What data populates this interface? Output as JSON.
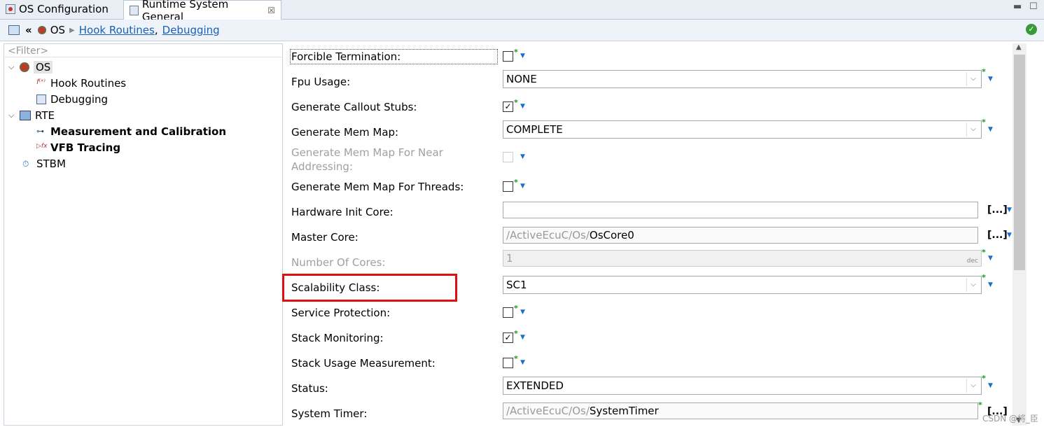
{
  "tabs": [
    {
      "label": "OS Configuration"
    },
    {
      "label": "Runtime System General"
    }
  ],
  "breadcrumb": {
    "root": "OS",
    "links": [
      "Hook Routines",
      "Debugging"
    ],
    "separator": ","
  },
  "tree": {
    "filter_placeholder": "<Filter>",
    "items": [
      {
        "label": "OS",
        "level": 0,
        "expanded": true,
        "selected": true
      },
      {
        "label": "Hook Routines",
        "level": 1
      },
      {
        "label": "Debugging",
        "level": 1
      },
      {
        "label": "RTE",
        "level": 0,
        "expanded": true
      },
      {
        "label": "Measurement and Calibration",
        "level": 1,
        "bold": true
      },
      {
        "label": "VFB Tracing",
        "level": 1,
        "bold": true
      },
      {
        "label": "STBM",
        "level": 0
      }
    ]
  },
  "form": {
    "fields": [
      {
        "label": "Forcible Termination:",
        "type": "checkbox",
        "checked": false
      },
      {
        "label": "Fpu Usage:",
        "type": "combo",
        "value": "NONE"
      },
      {
        "label": "Generate Callout Stubs:",
        "type": "checkbox",
        "checked": true
      },
      {
        "label": "Generate Mem Map:",
        "type": "combo",
        "value": "COMPLETE"
      },
      {
        "label_line1": "Generate Mem Map For Near",
        "label_line2": "Addressing:",
        "type": "checkbox",
        "checked": false,
        "disabled": true
      },
      {
        "label": "Generate Mem Map For Threads:",
        "type": "checkbox",
        "checked": false
      },
      {
        "label": "Hardware Init Core:",
        "type": "reference",
        "value": ""
      },
      {
        "label": "Master Core:",
        "type": "reference",
        "prefix": "/ActiveEcuC/Os/",
        "value": "OsCore0"
      },
      {
        "label": "Number Of Cores:",
        "type": "number",
        "value": "1",
        "unit": "dec",
        "disabled": true
      },
      {
        "label": "Scalability Class:",
        "type": "combo",
        "value": "SC1",
        "highlighted": true
      },
      {
        "label": "Service Protection:",
        "type": "checkbox",
        "checked": false
      },
      {
        "label": "Stack Monitoring:",
        "type": "checkbox",
        "checked": true
      },
      {
        "label": "Stack Usage Measurement:",
        "type": "checkbox",
        "checked": false
      },
      {
        "label": "Status:",
        "type": "combo",
        "value": "EXTENDED"
      },
      {
        "label": "System Timer:",
        "type": "reference",
        "prefix": "/ActiveEcuC/Os/",
        "value": "SystemTimer"
      }
    ],
    "browse_label": "[...]",
    "checkmark": "✓",
    "modified_marker": "*",
    "dropdown_marker": "▼"
  },
  "watermark": "CSDN @将_臣",
  "colors": {
    "highlight_box": "#e01010",
    "link": "#1a5fb4",
    "modified": "#1a9a1a"
  }
}
